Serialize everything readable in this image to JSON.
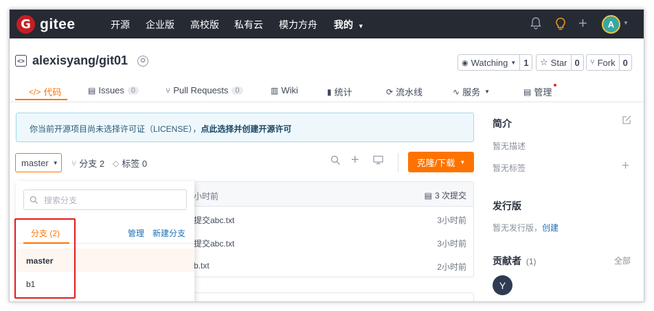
{
  "nav": {
    "logo_mark": "G",
    "logo_text": "gitee",
    "items": [
      "开源",
      "企业版",
      "高校版",
      "私有云",
      "模力方舟"
    ],
    "mine": "我的",
    "avatar_letter": "A"
  },
  "repo": {
    "name": "alexisyang/git01",
    "watch_label": "Watching",
    "watch_count": "1",
    "star_label": "Star",
    "star_count": "0",
    "fork_label": "Fork",
    "fork_count": "0"
  },
  "tabs": [
    {
      "label": "代码"
    },
    {
      "label": "Issues",
      "count": "0"
    },
    {
      "label": "Pull Requests",
      "count": "0"
    },
    {
      "label": "Wiki"
    },
    {
      "label": "统计"
    },
    {
      "label": "流水线"
    },
    {
      "label": "服务"
    },
    {
      "label": "管理"
    }
  ],
  "notice": {
    "text": "你当前开源项目尚未选择许可证（LICENSE），",
    "link": "点此选择并创建开源许可"
  },
  "toolbar": {
    "branch": "master",
    "branch_count": "分支 2",
    "tag_count": "标签 0",
    "clone_label": "克隆/下载"
  },
  "files": {
    "header_time": "小时前",
    "commits": "3 次提交",
    "rows": [
      {
        "name": "提交abc.txt",
        "time": "3小时前"
      },
      {
        "name": "提交abc.txt",
        "time": "3小时前"
      },
      {
        "name": "b.txt",
        "time": "2小时前"
      }
    ]
  },
  "dropdown": {
    "search_placeholder": "搜索分支",
    "tab_label": "分支 (2)",
    "manage": "管理",
    "new_branch": "新建分支",
    "branches": [
      "master",
      "b1"
    ]
  },
  "sidebar": {
    "intro_title": "简介",
    "no_desc": "暂无描述",
    "no_tags": "暂无标签",
    "release_title": "发行版",
    "no_release": "暂无发行版，",
    "create": "创建",
    "contrib_title": "贡献者",
    "contrib_count": "(1)",
    "all": "全部",
    "contrib_avatar": "Y"
  },
  "colors": {
    "accent": "#fe7300",
    "nav_bg": "#262a33",
    "highlight_border": "#e21a1a"
  }
}
